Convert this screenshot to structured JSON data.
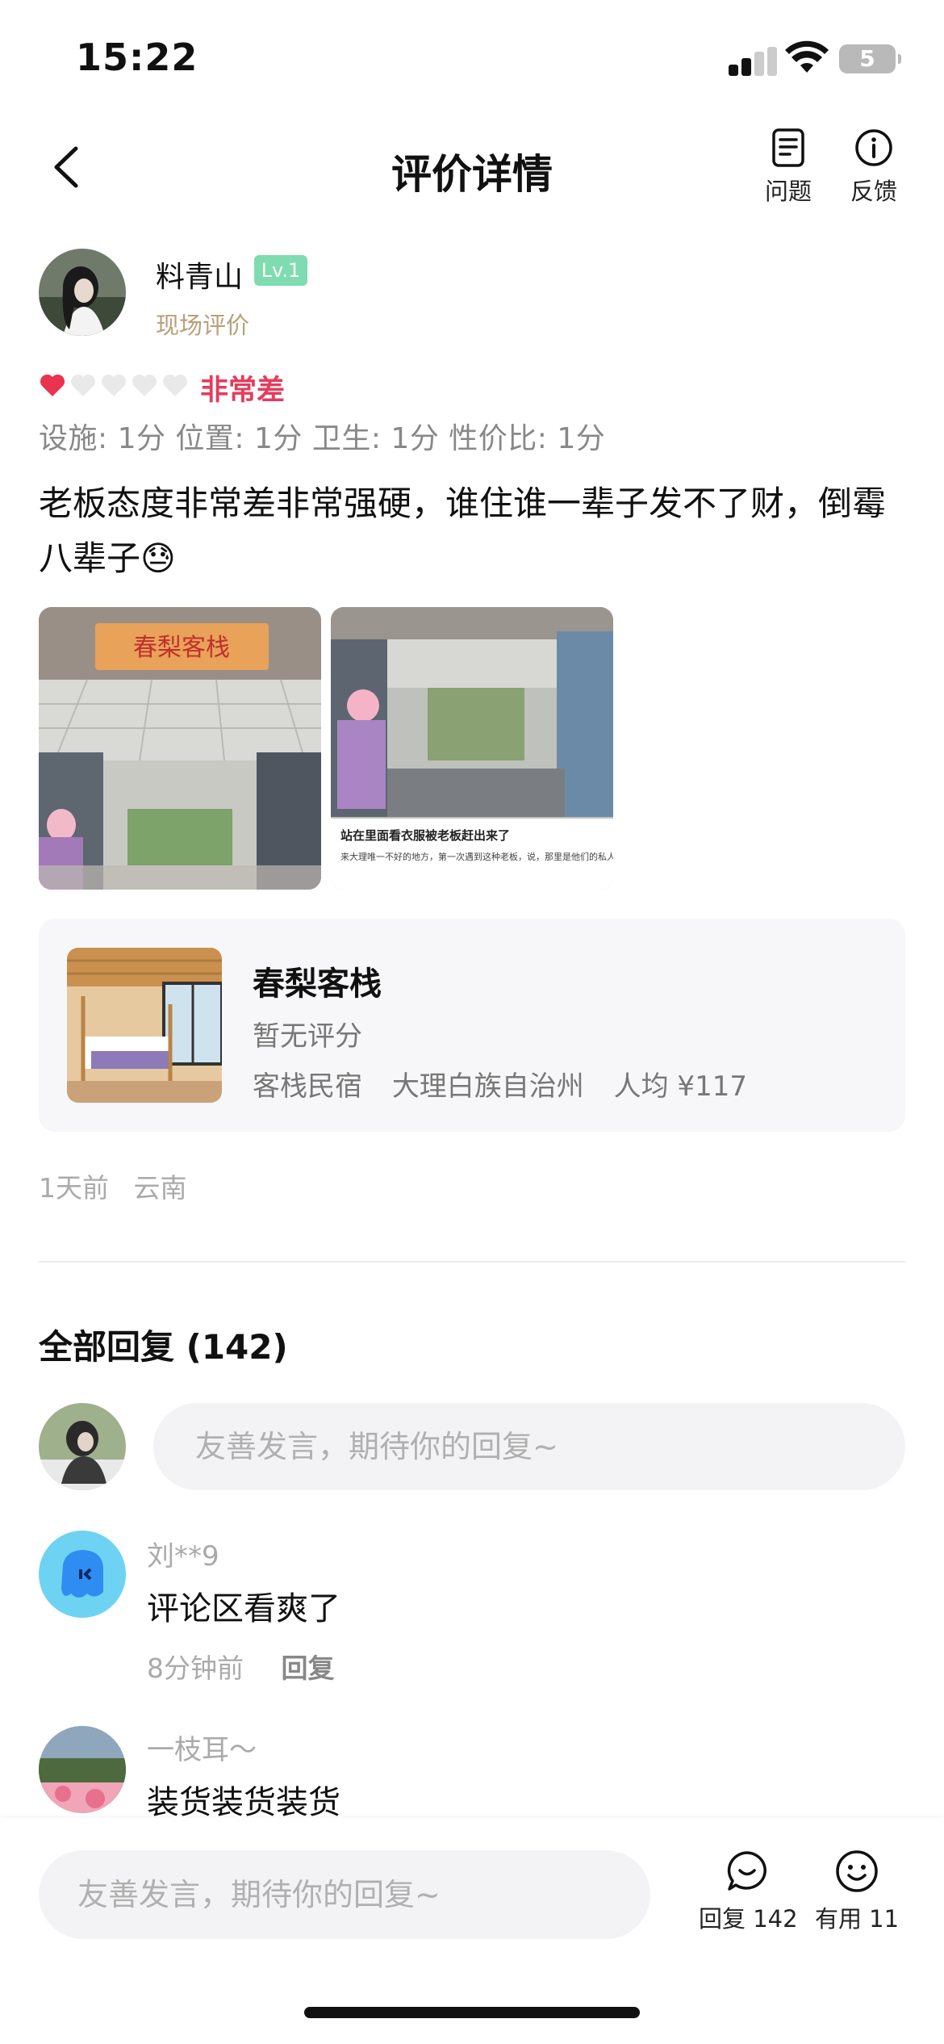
{
  "status_bar": {
    "time": "15:22",
    "battery": "5"
  },
  "nav": {
    "title": "评价详情",
    "actions": [
      {
        "label": "问题",
        "icon": "document-icon"
      },
      {
        "label": "反馈",
        "icon": "info-icon"
      }
    ]
  },
  "review": {
    "user_name": "料青山",
    "level": "Lv.1",
    "review_type": "现场评价",
    "rating_hearts": 1,
    "rating_max": 5,
    "rating_text": "非常差",
    "scores": "设施: 1分  位置: 1分  卫生: 1分  性价比: 1分",
    "text": "老板态度非常差非常强硬，谁住谁一辈子发不了财，倒霉八辈子😓",
    "photos": [
      {
        "sign_text": "春梨客栈"
      },
      {
        "caption_title": "站在里面看衣服被老板赶出来了",
        "caption_body": "来大理唯一不好的地方，第一次遇到这种老板，说，那里是他们的私人区域，不可以站在那里，然"
      }
    ],
    "time": "1天前",
    "location": "云南"
  },
  "hotel": {
    "name": "春梨客栈",
    "rating": "暂无评分",
    "category": "客栈民宿",
    "area": "大理白族自治州",
    "price": "人均 ¥117"
  },
  "replies": {
    "title": "全部回复 (142)",
    "input_placeholder": "友善发言，期待你的回复~",
    "items": [
      {
        "name": "刘**9",
        "text": "评论区看爽了",
        "time": "8分钟前",
        "reply_label": "回复"
      },
      {
        "name": "一枝耳～",
        "text": "装货装货装货",
        "time": "",
        "reply_label": ""
      }
    ]
  },
  "bottom_bar": {
    "input_placeholder": "友善发言，期待你的回复~",
    "reply_label": "回复 142",
    "useful_label": "有用 11"
  },
  "colors": {
    "accent_red": "#e53c5c",
    "level_badge": "#7fdcb0",
    "muted": "#aaaaaa"
  }
}
